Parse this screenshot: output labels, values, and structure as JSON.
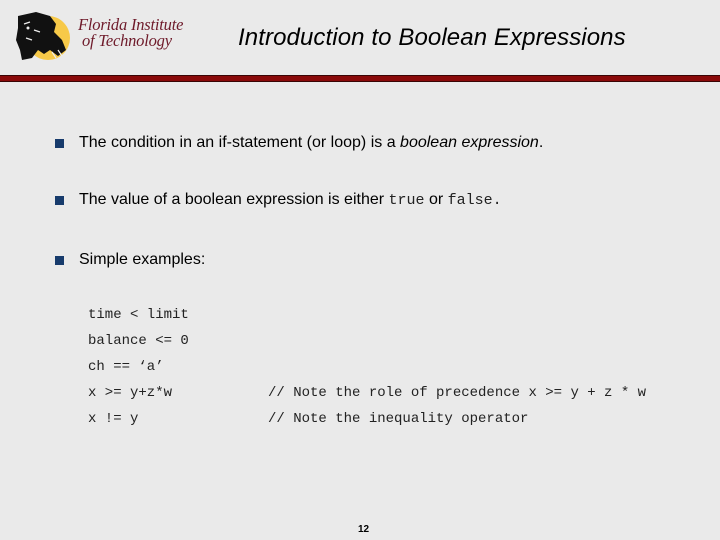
{
  "header": {
    "logo": {
      "line1": "Florida Institute",
      "line2": "of Technology",
      "emblem": "panther-icon"
    },
    "title": "Introduction to Boolean Expressions"
  },
  "colors": {
    "accent_rule": "#8a0a0a",
    "bullet": "#173b6c",
    "logo_text": "#6e1a2a",
    "background": "#eaeaea"
  },
  "bullets": [
    {
      "pre": "The condition in an if-statement (or loop) is a ",
      "em": "boolean expression",
      "post": "."
    },
    {
      "pre": "The value of a boolean expression is either ",
      "code1": "true",
      "mid": " or ",
      "code2": "false.",
      "post": ""
    },
    {
      "text": "Simple examples:"
    }
  ],
  "examples": [
    {
      "code": "time < limit",
      "comment": ""
    },
    {
      "code": "balance <= 0",
      "comment": ""
    },
    {
      "code": "ch == ‘a’",
      "comment": ""
    },
    {
      "code": "x >= y+z*w",
      "comment": "// Note the role of precedence x >= y + z * w"
    },
    {
      "code": "x != y",
      "comment": "// Note the inequality operator"
    }
  ],
  "footer": {
    "page_number": "12"
  }
}
